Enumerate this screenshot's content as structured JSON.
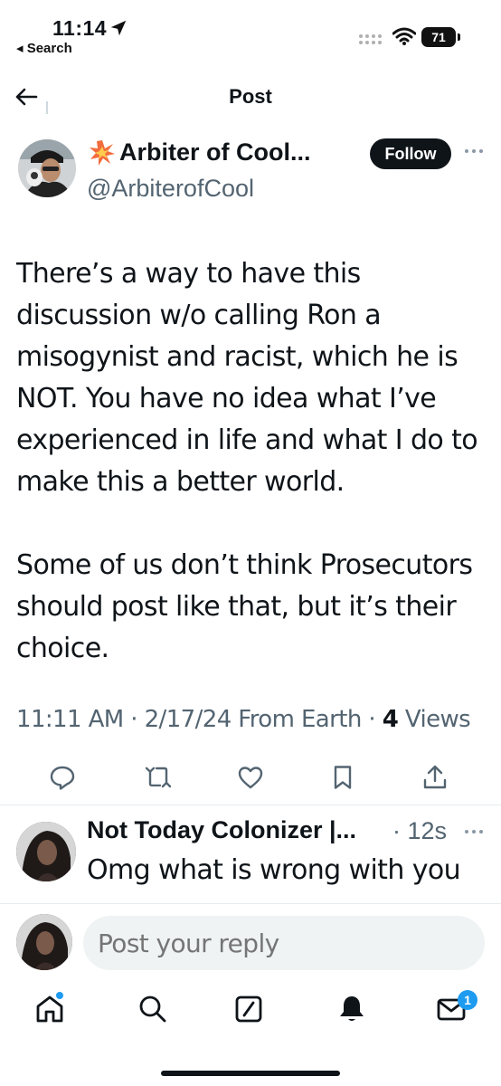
{
  "status_bar": {
    "time": "11:14",
    "back_label": "◂ Search",
    "battery": "71"
  },
  "header": {
    "title": "Post"
  },
  "author": {
    "name": "Arbiter of Cool...",
    "handle": "@ArbiterofCool",
    "follow_label": "Follow"
  },
  "post": {
    "paragraph1": "There’s a way to have this discussion w/o calling Ron a misogynist and racist, which he is NOT. You have no idea what I’ve experienced in life and what I do to make this a better world.",
    "paragraph2": "Some of us don’t think Prosecutors should  post like that, but it’s their choice.",
    "meta_prefix": "11:11 AM · 2/17/24 From Earth · ",
    "views_count": "4",
    "views_label": " Views"
  },
  "reply": {
    "name": "Not Today Colonizer |...",
    "time": "· 12s",
    "text": "Omg what is wrong with you"
  },
  "compose": {
    "placeholder": "Post your reply"
  },
  "tab_bar": {
    "messages_badge": "1"
  },
  "colors": {
    "accent": "#1d9bf0",
    "text": "#0f1419",
    "secondary": "#536471"
  }
}
